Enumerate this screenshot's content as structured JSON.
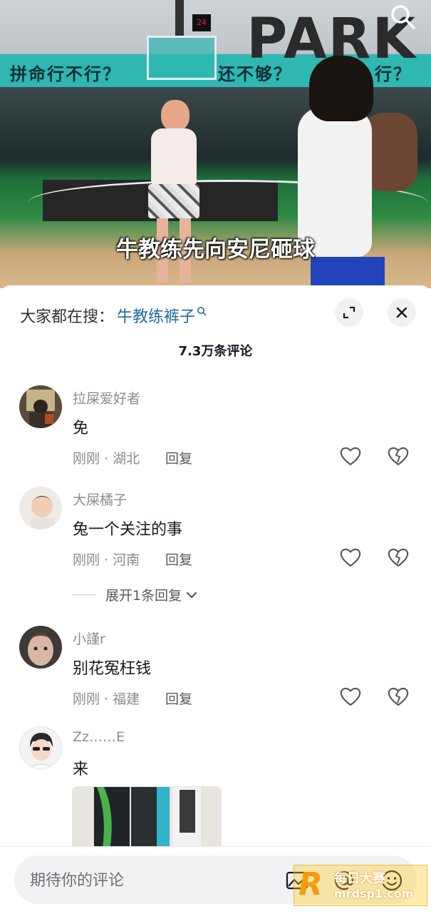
{
  "video": {
    "caption": "牛教练先向安尼砸球",
    "wall_text_left": "拼命行不行？",
    "wall_text_mid": "还不够？",
    "wall_text_right": "行？",
    "park_text": "PARK",
    "shot_clock": "24"
  },
  "hot_search": {
    "prefix": "大家都在搜：",
    "term": "牛教练裤子"
  },
  "comment_count": "7.3万条评论",
  "comments": [
    {
      "name": "拉屎爱好者",
      "text": "免",
      "time": "刚刚",
      "location": "湖北",
      "reply": "回复"
    },
    {
      "name": "大屎橘子",
      "text": "兔一个关注的事",
      "time": "刚刚",
      "location": "河南",
      "reply": "回复"
    },
    {
      "name": "小謹r",
      "text": "别花冤枉钱",
      "time": "刚刚",
      "location": "福建",
      "reply": "回复"
    },
    {
      "name": "Zz……E",
      "text": "来"
    }
  ],
  "expand_replies": "展开1条回复",
  "input": {
    "placeholder": "期待你的评论"
  },
  "watermark": {
    "line1": "每日大赛",
    "line2": "mrdsp1.com",
    "logo": "R"
  },
  "colors": {
    "accent_link": "#1d6b9a",
    "muted_text": "#8a8b91",
    "court_teal": "#2fb7b2"
  }
}
